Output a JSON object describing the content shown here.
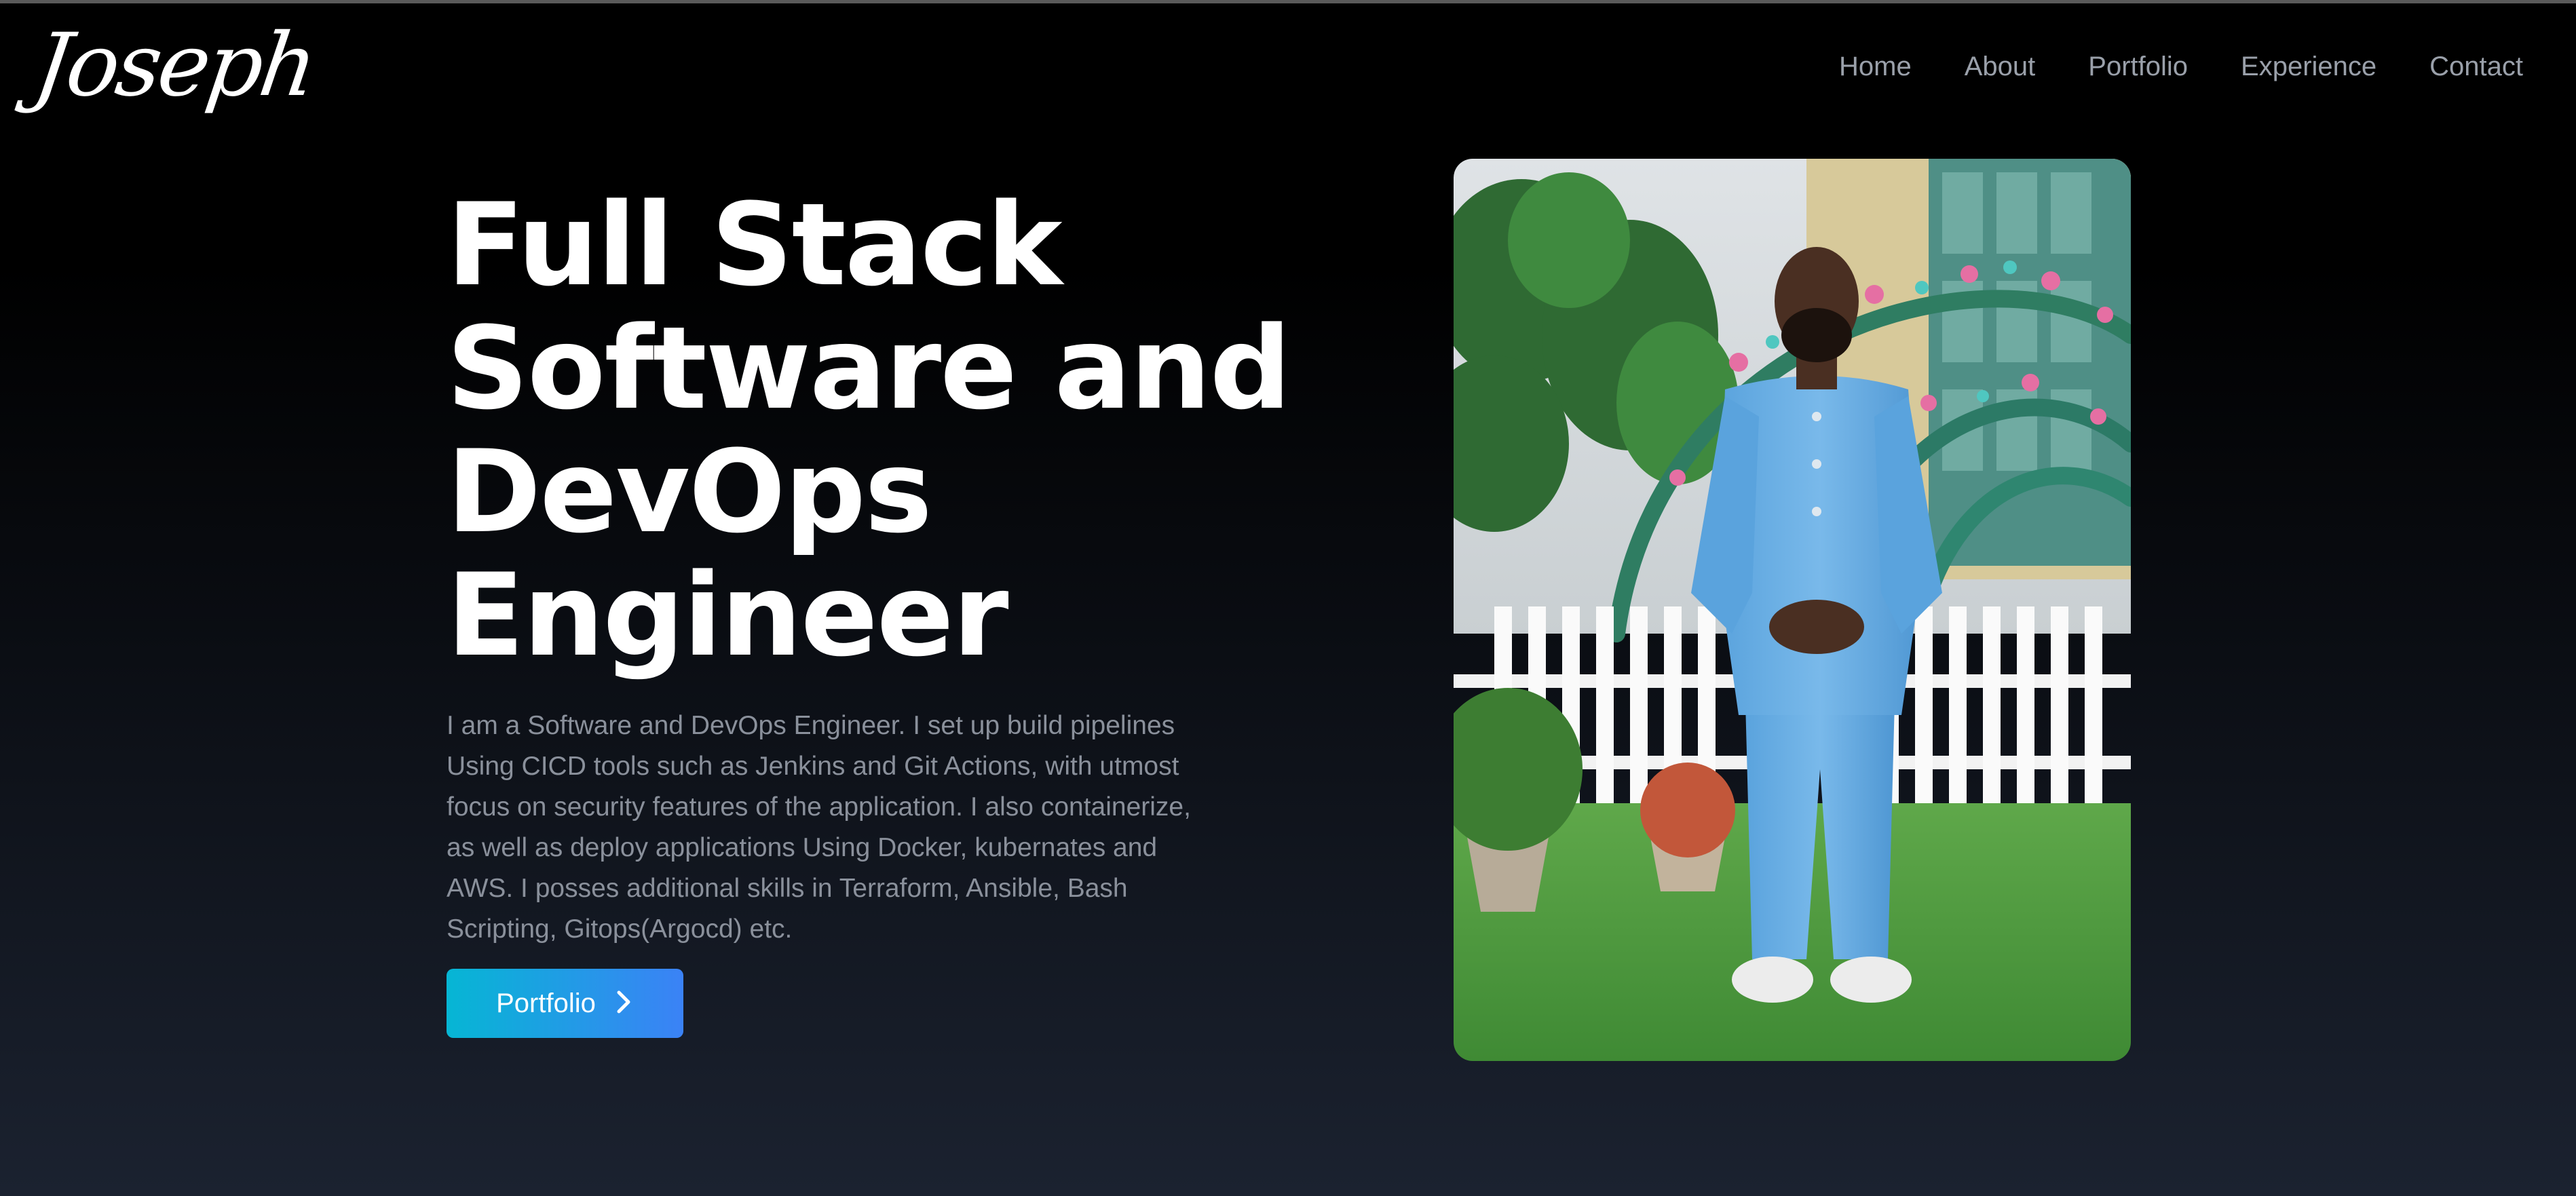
{
  "logo": {
    "text": "Joseph"
  },
  "nav": {
    "items": [
      {
        "label": "Home"
      },
      {
        "label": "About"
      },
      {
        "label": "Portfolio"
      },
      {
        "label": "Experience"
      },
      {
        "label": "Contact"
      }
    ]
  },
  "hero": {
    "headline_lines": [
      "Full Stack",
      "Software and",
      "DevOps",
      "Engineer"
    ],
    "description": "I am a Software and DevOps Engineer. I set up build pipelines Using CICD tools such as Jenkins and Git Actions, with utmost focus on security features of the application. I also containerize, as well as deploy applications Using Docker, kubernates and AWS. I posses additional skills in Terraform, Ansible, Bash Scripting, Gitops(Argocd) etc.",
    "cta_label": "Portfolio",
    "cta_icon": "chevron-right-icon"
  },
  "colors": {
    "background_top": "#000000",
    "background_bottom": "#1b2230",
    "button_gradient_start": "#06b6d4",
    "button_gradient_end": "#3b82f6",
    "nav_text": "#9aa0aa",
    "description_text": "#8a909b"
  }
}
